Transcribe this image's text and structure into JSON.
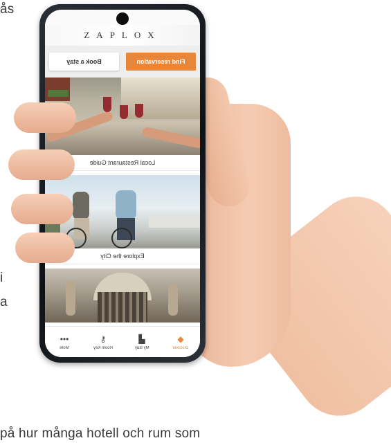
{
  "page_text": {
    "top_fragment": "ås",
    "mid_fragment_1": "i",
    "mid_fragment_2": "a",
    "bottom_fragment": "på hur många hotell och rum som"
  },
  "app": {
    "brand": "ZAPLOX",
    "buttons": {
      "find_reservation": "Find reservation",
      "book_a_stay": "Book a stay"
    },
    "cards": [
      {
        "caption": "Local Restaurant Guide"
      },
      {
        "caption": "Explore the City"
      },
      {
        "caption": ""
      }
    ],
    "nav": [
      {
        "label": "Discover",
        "icon": "tag-icon",
        "active": true
      },
      {
        "label": "My stay",
        "icon": "bed-icon",
        "active": false
      },
      {
        "label": "Room Key",
        "icon": "key-icon",
        "active": false
      },
      {
        "label": "More",
        "icon": "more-dots-icon",
        "active": false
      }
    ],
    "colors": {
      "accent": "#e8873a"
    }
  }
}
